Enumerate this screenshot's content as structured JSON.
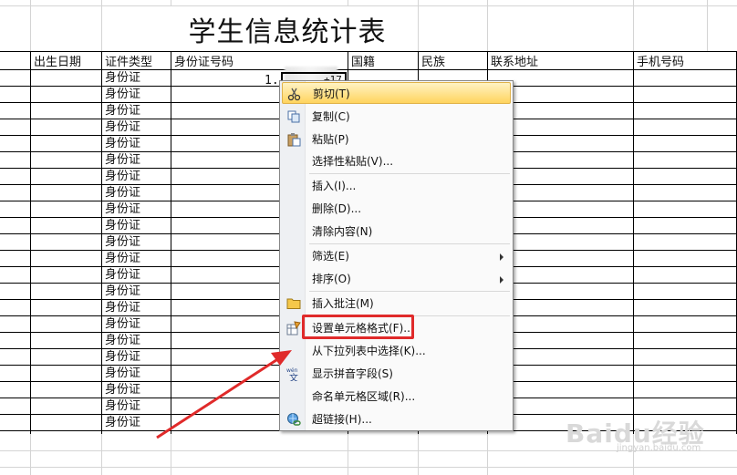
{
  "sheet": {
    "title": "学生信息统计表",
    "headers": [
      "出生日期",
      "证件类型",
      "身份证号码",
      "国籍",
      "民族",
      "联系地址",
      "手机号码"
    ],
    "id_type_value": "身份证",
    "id_type_rows": [
      "身份证",
      "身份证",
      "身份证",
      "身份证",
      "身份证",
      "身份证",
      "身份证",
      "身份证",
      "身份证",
      "身份证",
      "身份证",
      "身份证",
      "身份证",
      "身份证",
      "身份证",
      "身份证",
      "身份证",
      "身份证",
      "身份证",
      "身份证",
      "身份证",
      "身份证"
    ],
    "active_cell_value_prefix": "1.",
    "active_cell_value_suffix": "+17"
  },
  "context_menu": {
    "items": [
      {
        "label": "剪切(T)",
        "icon": "scissors-icon",
        "highlighted": true
      },
      {
        "label": "复制(C)",
        "icon": "copy-icon"
      },
      {
        "label": "粘贴(P)",
        "icon": "paste-icon"
      },
      {
        "label": "选择性粘贴(V)...",
        "icon": ""
      },
      {
        "label": "插入(I)...",
        "icon": ""
      },
      {
        "label": "删除(D)...",
        "icon": ""
      },
      {
        "label": "清除内容(N)",
        "icon": ""
      },
      {
        "label": "筛选(E)",
        "icon": "",
        "submenu": true
      },
      {
        "label": "排序(O)",
        "icon": "",
        "submenu": true
      },
      {
        "label": "插入批注(M)",
        "icon": "comment-icon"
      },
      {
        "label": "设置单元格格式(F)...",
        "icon": "format-cells-icon"
      },
      {
        "label": "从下拉列表中选择(K)...",
        "icon": ""
      },
      {
        "label": "显示拼音字段(S)",
        "icon": "phonetic-icon"
      },
      {
        "label": "命名单元格区域(R)...",
        "icon": ""
      },
      {
        "label": "超链接(H)...",
        "icon": "hyperlink-icon"
      }
    ]
  },
  "watermark": {
    "brand": "Baidu经验",
    "url": "jingyan.baidu.com"
  },
  "colors": {
    "annotation_red": "#e02a2a",
    "menu_highlight": "#ffd45e"
  }
}
